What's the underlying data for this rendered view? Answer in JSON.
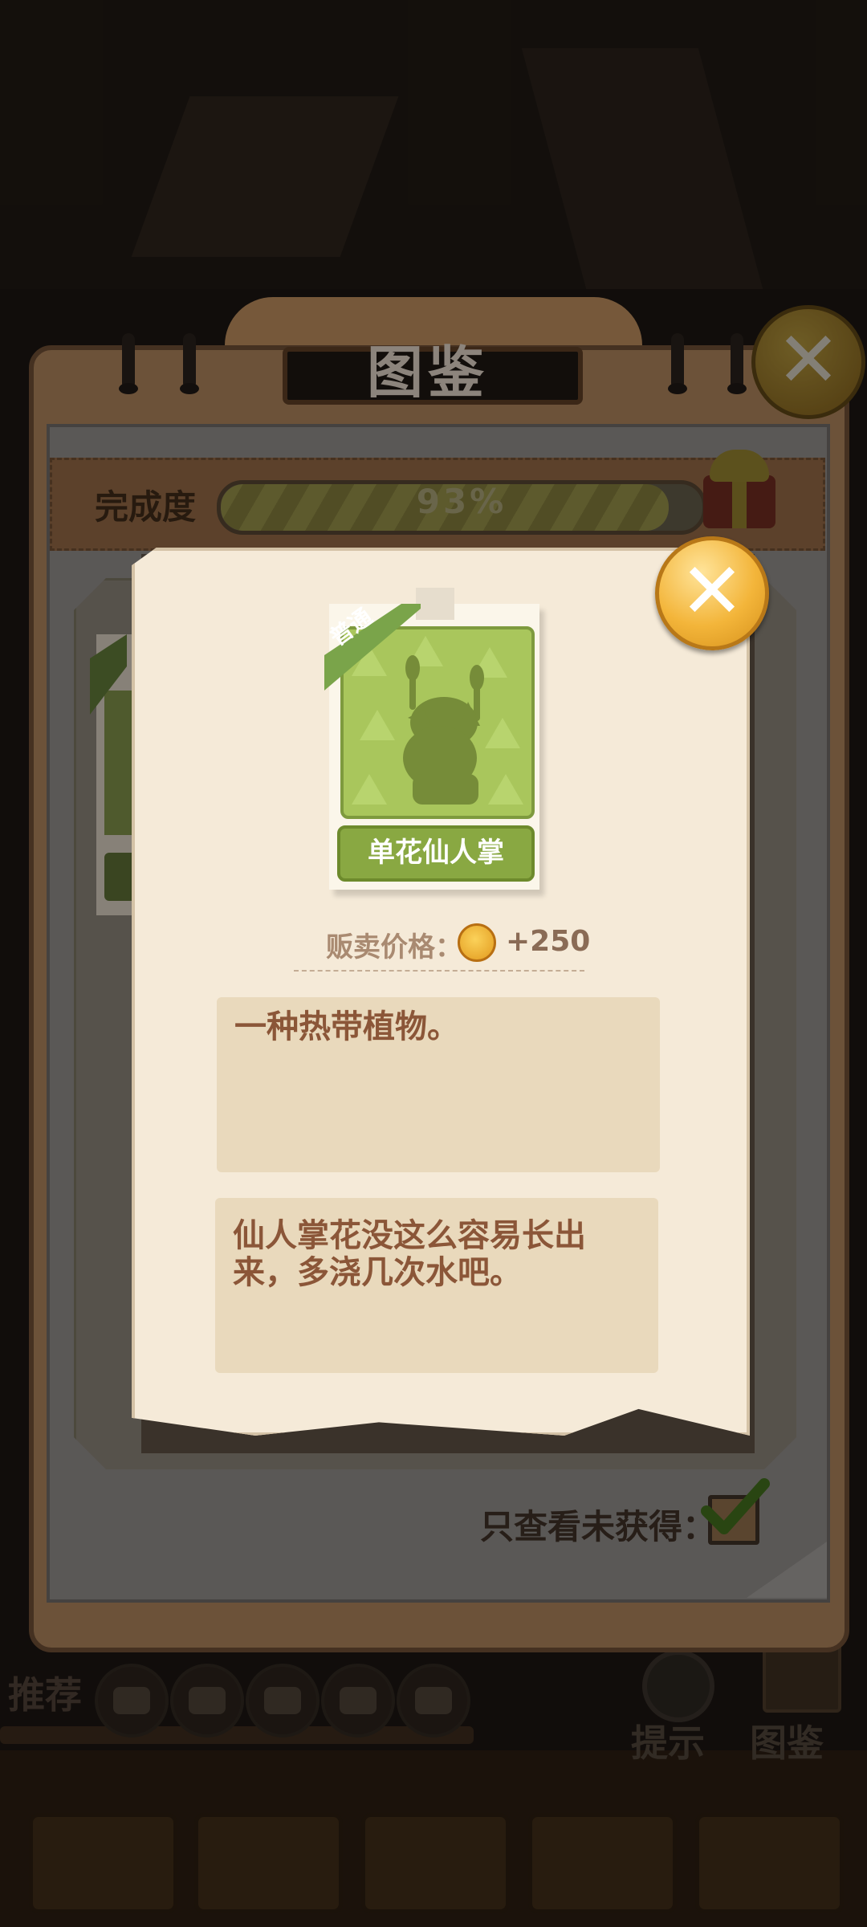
{
  "catalog": {
    "title": "图鉴",
    "progress_label": "完成度",
    "progress_percent": 93,
    "progress_text": "93%",
    "filter_label": "只查看未获得：",
    "filter_checked": true
  },
  "bottom_bar": {
    "recommend_label": "推荐",
    "hint_label": "提示",
    "catalog_label": "图鉴"
  },
  "detail": {
    "rarity_tag": "普通",
    "plant_name": "单花仙人掌",
    "price_label": "贩卖价格：",
    "price_value": "+250",
    "description": "一种热带植物。",
    "hint": "仙人掌花没这么容易长出来，多浇几次水吧。"
  },
  "colors": {
    "accent_green": "#89a842",
    "close_gold": "#f3b53a",
    "text_brown": "#8b5638"
  }
}
